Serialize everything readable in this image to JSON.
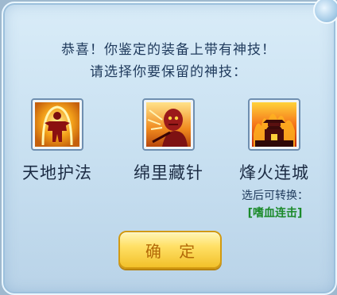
{
  "dialog": {
    "message_line1": "恭喜！你鉴定的装备上带有神技！",
    "message_line2": "请选择你要保留的神技：",
    "skills": [
      {
        "name": "天地护法",
        "icon": "guardian-figure-icon"
      },
      {
        "name": "绵里藏针",
        "icon": "needle-warrior-icon"
      },
      {
        "name": "烽火连城",
        "icon": "burning-fortress-icon"
      }
    ],
    "convert_hint": "选后可转换：",
    "convert_target": "[嗜血连击]",
    "confirm_label": "确 定"
  }
}
